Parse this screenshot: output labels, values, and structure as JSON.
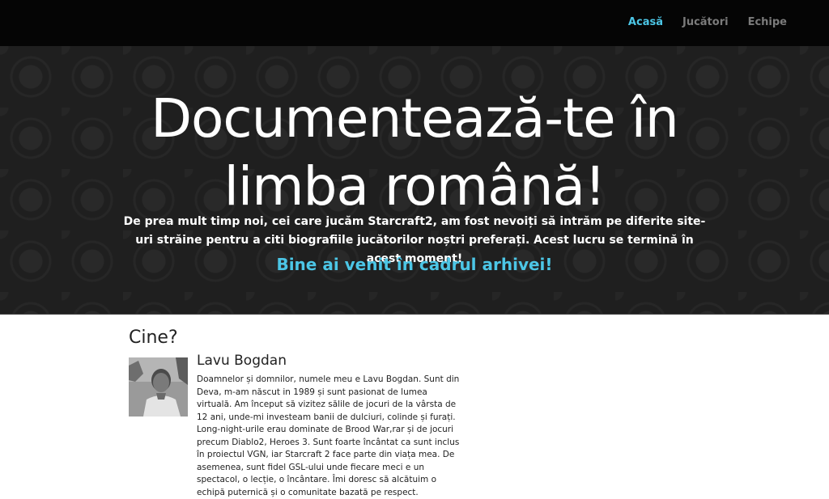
{
  "nav": {
    "items": [
      {
        "label": "Acasă",
        "active": true
      },
      {
        "label": "Jucători",
        "active": false
      },
      {
        "label": "Echipe",
        "active": false
      }
    ]
  },
  "hero": {
    "title_line1": "Documentează-te în",
    "title_line2": "limba română!",
    "text": "De prea mult timp noi, cei care jucăm Starcraft2, am fost nevoiți să intrăm pe diferite site-uri străine pentru a citi biografiile jucătorilor noștri preferați. Acest lucru se termină în acest moment!",
    "welcome": "Bine ai venit în cadrul arhivei!"
  },
  "section": {
    "title": "Cine?"
  },
  "member": {
    "name": "Lavu Bogdan",
    "bio": "Doamnelor și domnilor, numele meu e Lavu Bogdan. Sunt din Deva, m-am născut in 1989 și sunt pasionat de lumea virtuală. Am început să vizitez sălile de jocuri de la vârsta de 12 ani, unde-mi investeam banii de dulciuri, colinde și furați. Long-night-urile erau dominate de Brood War,rar și de jocuri precum Diablo2, Heroes 3. Sunt foarte încântat ca sunt inclus în proiectul VGN, iar Starcraft 2 face parte din viața mea. De asemenea, sunt fidel GSL-ului unde fiecare meci e un spectacol, o lecție, o încântare. Îmi doresc să alcătuim o echipă puternică și o comunitate bazată pe respect."
  },
  "colors": {
    "accent": "#4cc6e6",
    "navbar": "#050505",
    "hero_bg": "#1f1f1f"
  }
}
